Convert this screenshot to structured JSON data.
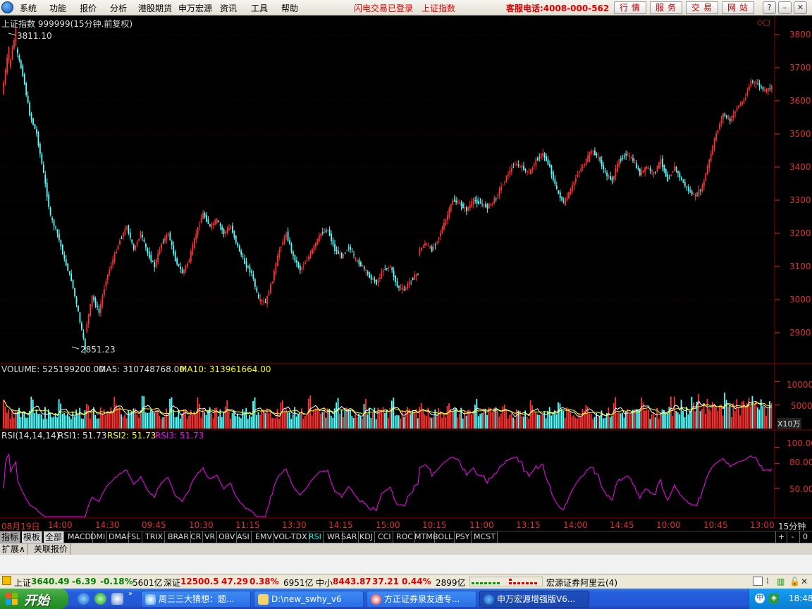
{
  "menubar": {
    "items": [
      "系统",
      "功能",
      "报价",
      "分析",
      "港股期货",
      "申万宏源",
      "资讯",
      "工具",
      "帮助"
    ],
    "login_status": "闪电交易已登录",
    "current_index": "上证指数",
    "hotline": "客服电话:4008-000-562",
    "buttons": [
      "行情",
      "服务",
      "交易",
      "网站"
    ]
  },
  "chart": {
    "title": "上证指数 999999(15分钟.前复权)",
    "high_label": "3811.10",
    "low_label": "2851.23",
    "price_ticks": [
      "3800",
      "3700",
      "3600",
      "3500",
      "3400",
      "3300",
      "3200",
      "3100",
      "3000",
      "2900"
    ],
    "volume": {
      "label": "VOLUME: 525199200.00",
      "ma5": "MA5: 310748768.00",
      "ma10": "MA10: 313961664.00",
      "ticks": [
        "10000",
        "5000"
      ],
      "unit": "X10万"
    },
    "rsi": {
      "label": "RSI(14,14,14)",
      "rsi1": "RSI1: 51.73",
      "rsi2": "RSI2: 51.73",
      "rsi3": "RSI3: 51.73",
      "ticks": [
        "100.00",
        "80.00",
        "50.00"
      ]
    },
    "time_labels": [
      "08月19日",
      "14:00",
      "14:30",
      "09:45",
      "10:30",
      "11:15",
      "13:30",
      "14:15",
      "15:00",
      "10:15",
      "11:00",
      "13:15",
      "14:00",
      "14:45",
      "10:00",
      "10:45",
      "13:00"
    ],
    "period": "15分钟",
    "colors": {
      "up": "#ff3232",
      "down": "#54ffff",
      "ma5": "#ffffff",
      "ma10": "#ffff00",
      "rsi": "#ff00ff",
      "grid": "#8b0000"
    }
  },
  "chart_data": {
    "type": "candlestick",
    "series": [
      {
        "name": "上证指数",
        "points": [
          [
            3620,
            3760
          ],
          [
            3700,
            3811.1
          ],
          [
            3760,
            3680
          ],
          [
            3680,
            3560
          ],
          [
            3560,
            3500
          ],
          [
            3500,
            3380
          ],
          [
            3380,
            3250
          ],
          [
            3250,
            3200
          ],
          [
            3200,
            3120
          ],
          [
            3120,
            3060
          ],
          [
            3060,
            2960
          ],
          [
            2960,
            2851.23
          ],
          [
            2900,
            3010
          ],
          [
            3010,
            2960
          ],
          [
            2960,
            3060
          ],
          [
            3060,
            3120
          ],
          [
            3120,
            3180
          ],
          [
            3180,
            3220
          ],
          [
            3220,
            3150
          ],
          [
            3150,
            3200
          ],
          [
            3200,
            3140
          ],
          [
            3140,
            3100
          ],
          [
            3100,
            3170
          ],
          [
            3170,
            3200
          ],
          [
            3200,
            3120
          ],
          [
            3120,
            3080
          ],
          [
            3080,
            3120
          ],
          [
            3120,
            3200
          ],
          [
            3200,
            3260
          ],
          [
            3260,
            3220
          ],
          [
            3220,
            3240
          ],
          [
            3240,
            3200
          ],
          [
            3200,
            3220
          ],
          [
            3220,
            3160
          ],
          [
            3160,
            3110
          ],
          [
            3110,
            3080
          ],
          [
            3080,
            3000
          ],
          [
            3000,
            2990
          ],
          [
            2990,
            3060
          ],
          [
            3060,
            3150
          ],
          [
            3150,
            3200
          ],
          [
            3200,
            3130
          ],
          [
            3130,
            3090
          ],
          [
            3090,
            3120
          ],
          [
            3120,
            3160
          ],
          [
            3160,
            3200
          ],
          [
            3200,
            3210
          ],
          [
            3210,
            3150
          ],
          [
            3150,
            3130
          ],
          [
            3130,
            3160
          ],
          [
            3160,
            3120
          ],
          [
            3120,
            3100
          ],
          [
            3100,
            3070
          ],
          [
            3070,
            3050
          ],
          [
            3050,
            3090
          ],
          [
            3090,
            3100
          ],
          [
            3100,
            3040
          ],
          [
            3040,
            3030
          ],
          [
            3030,
            3060
          ],
          [
            3060,
            3080
          ],
          [
            3140,
            3170
          ],
          [
            3170,
            3150
          ],
          [
            3150,
            3190
          ],
          [
            3190,
            3240
          ],
          [
            3240,
            3300
          ],
          [
            3300,
            3290
          ],
          [
            3290,
            3270
          ],
          [
            3270,
            3300
          ],
          [
            3300,
            3290
          ],
          [
            3290,
            3280
          ],
          [
            3280,
            3300
          ],
          [
            3300,
            3340
          ],
          [
            3340,
            3380
          ],
          [
            3380,
            3410
          ],
          [
            3410,
            3400
          ],
          [
            3400,
            3380
          ],
          [
            3380,
            3420
          ],
          [
            3420,
            3440
          ],
          [
            3440,
            3400
          ],
          [
            3400,
            3330
          ],
          [
            3330,
            3290
          ],
          [
            3290,
            3330
          ],
          [
            3330,
            3380
          ],
          [
            3380,
            3410
          ],
          [
            3410,
            3450
          ],
          [
            3450,
            3430
          ],
          [
            3430,
            3380
          ],
          [
            3380,
            3360
          ],
          [
            3360,
            3420
          ],
          [
            3420,
            3440
          ],
          [
            3440,
            3420
          ],
          [
            3420,
            3380
          ],
          [
            3380,
            3400
          ],
          [
            3400,
            3380
          ],
          [
            3380,
            3420
          ],
          [
            3420,
            3360
          ],
          [
            3360,
            3400
          ],
          [
            3400,
            3360
          ],
          [
            3360,
            3330
          ],
          [
            3330,
            3310
          ],
          [
            3310,
            3340
          ],
          [
            3340,
            3420
          ],
          [
            3420,
            3500
          ],
          [
            3500,
            3560
          ],
          [
            3560,
            3540
          ],
          [
            3540,
            3580
          ],
          [
            3580,
            3600
          ],
          [
            3600,
            3660
          ],
          [
            3660,
            3650
          ],
          [
            3650,
            3630
          ],
          [
            3630,
            3640.49
          ]
        ]
      }
    ]
  },
  "tabs": [
    "指标",
    "模板",
    "全部",
    "MACD",
    "DMI",
    "DMA",
    "FSL",
    "TRIX",
    "BRAR",
    "CR",
    "VR",
    "OBV",
    "ASI",
    "EMV",
    "VOL-TDX",
    "RSI",
    "WR",
    "SAR",
    "KDJ",
    "CCI",
    "ROC",
    "MTM",
    "BOLL",
    "PSY",
    "MCST"
  ],
  "tab_controls": [
    "+",
    "-",
    "0"
  ],
  "ext_tabs": [
    "扩展∧",
    "关联报价"
  ],
  "status": {
    "sh_name": "上证",
    "sh_price": "3640.49",
    "sh_change": "-6.39",
    "sh_pct": "-0.18%",
    "sh_amount": "5601亿",
    "sz_name": "深证",
    "sz_price": "12500.5",
    "sz_change": "47.29",
    "sz_pct": "0.38%",
    "sz_amount": "6951亿",
    "zx_name": "中小",
    "zx_price": "8443.87",
    "zx_change": "37.21",
    "zx_pct": "0.44%",
    "zx_amount": "2899亿",
    "server": "宏源证券阿里云(4)"
  },
  "taskbar": {
    "start": "开始",
    "tasks": [
      "周三三大猜想：题...",
      "D:\\new_swhy_v6",
      "方正证券泉友通专...",
      "申万宏源增强版V6..."
    ],
    "clock": "18:48"
  }
}
